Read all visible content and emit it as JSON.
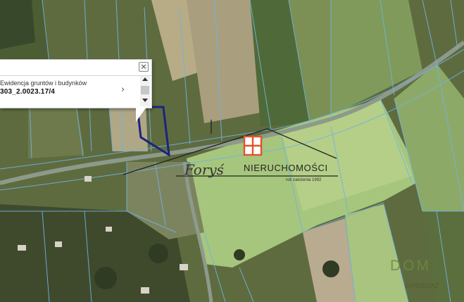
{
  "popup": {
    "layer_title": "Ewidencja gruntów i budynków",
    "parcel_id": "303_2.0023.17/4",
    "close_glyph": "×",
    "next_glyph": "›"
  },
  "watermark": {
    "company": "NIERUCHOMOŚCI",
    "script_name": "Foryś",
    "founded": "rok założenia 1992",
    "dom_logo": "DOM",
    "dom_sub": "SPRZEDAŻ"
  },
  "map": {
    "parcel_line_color": "#6fb3e3",
    "selected_parcel_color": "#1c237e",
    "road_color": "#8a9a8c",
    "marker_color": "#e2532c"
  }
}
